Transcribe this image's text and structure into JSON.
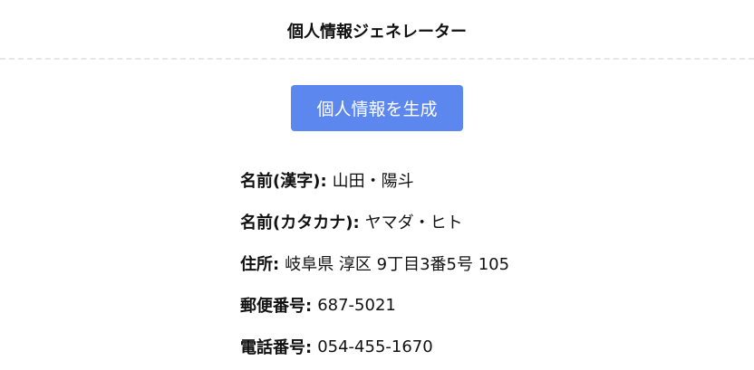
{
  "header": {
    "title": "個人情報ジェネレーター"
  },
  "actions": {
    "generate_label": "個人情報を生成"
  },
  "info": [
    {
      "label": "名前(漢字):",
      "value": "山田・陽斗"
    },
    {
      "label": "名前(カタカナ):",
      "value": "ヤマダ・ヒト"
    },
    {
      "label": "住所:",
      "value": "岐阜県 淳区 9丁目3番5号 105"
    },
    {
      "label": "郵便番号:",
      "value": "687-5021"
    },
    {
      "label": "電話番号:",
      "value": "054-455-1670"
    }
  ],
  "colors": {
    "button_bg": "#5b87ee",
    "divider": "#e6e6e6"
  }
}
